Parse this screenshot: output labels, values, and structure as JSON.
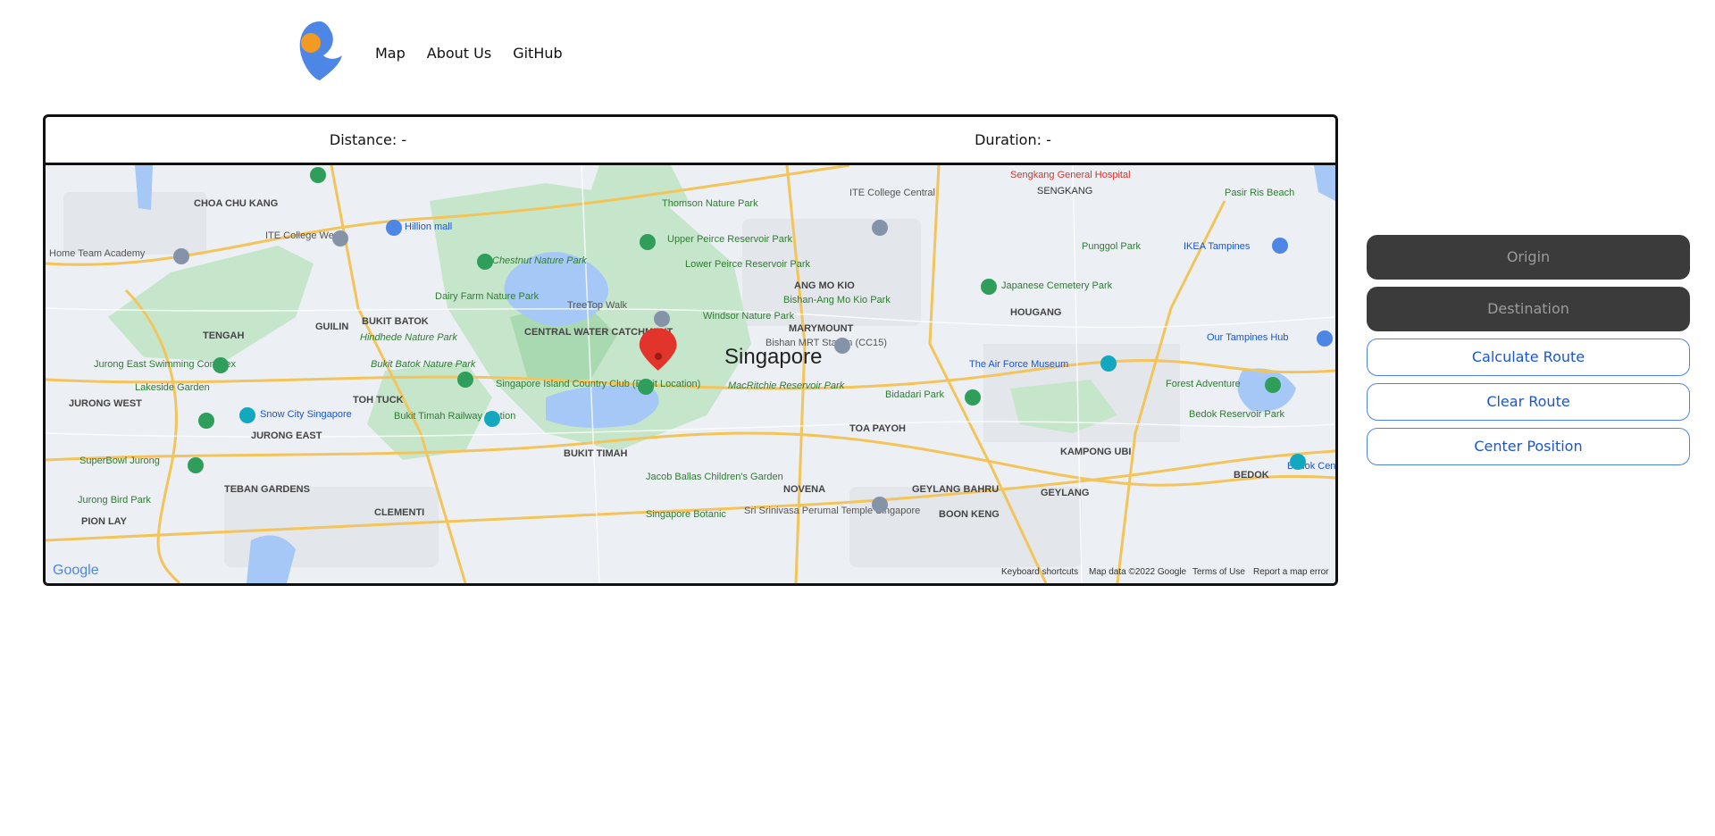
{
  "brand": {
    "logo_icon": "blue-pin-orange-dot-logo",
    "colors": {
      "logo_blue": "#4e86e6",
      "logo_orange": "#f29a24",
      "button_dark": "#3b3b3b",
      "button_link": "#1a55d6"
    }
  },
  "nav": {
    "items": [
      {
        "label": "Map"
      },
      {
        "label": "About Us"
      },
      {
        "label": "GitHub"
      }
    ]
  },
  "stats": {
    "distance_label": "Distance:",
    "distance_value": "-",
    "duration_label": "Duration:",
    "duration_value": "-"
  },
  "map": {
    "center_label": "Singapore",
    "marker_icon": "red-location-pin-icon",
    "attribution": {
      "google": "Google",
      "shortcuts": "Keyboard shortcuts",
      "map_data": "Map data ©2022 Google",
      "terms": "Terms of Use",
      "report": "Report a map error"
    },
    "labels": {
      "sengkang_hospital": "Sengkang General Hospital",
      "sengkang": "SENGKANG",
      "thomson": "Thomson Nature Park",
      "ite_central": "ITE College Central",
      "choa_chu_kang": "CHOA CHU KANG",
      "hillion": "Hillion mall",
      "ite_west": "ITE College West",
      "home_team": "Home Team Academy",
      "chestnut": "Chestnut Nature Park",
      "upper_peirce": "Upper Peirce Reservoir Park",
      "lower_peirce": "Lower Peirce Reservoir Park",
      "ang_mo_kio": "ANG MO KIO",
      "punggol_park": "Punggol Park",
      "pasir_ris": "Pasir Ris Beach",
      "ikea": "IKEA Tampines",
      "japanese_cemetery": "Japanese Cemetery Park",
      "dairy_farm": "Dairy Farm Nature Park",
      "treetop": "TreeTop Walk",
      "bishan_amk": "Bishan-Ang Mo Kio Park",
      "hougang": "HOUGANG",
      "tengah": "TENGAH",
      "guilin": "GUILIN",
      "bukit_batok": "BUKIT BATOK",
      "hindhede": "Hindhede Nature Park",
      "central_water": "CENTRAL WATER CATCHMENT",
      "windsor": "Windsor Nature Park",
      "marymount": "MARYMOUNT",
      "bishan_mrt": "Bishan MRT Station (CC15)",
      "our_tampines": "Our Tampines Hub",
      "jurong_east_swim": "Jurong East Swimming Complex",
      "bukit_batok_park": "Bukit Batok Nature Park",
      "lakeside": "Lakeside Garden",
      "sicc": "Singapore Island Country Club (Bukit Location)",
      "macritchie": "MacRitchie Reservoir Park",
      "air_force": "The Air Force Museum",
      "forest_adventure": "Forest Adventure",
      "jurong_west": "JURONG WEST",
      "toh_tuck": "TOH TUCK",
      "snow_city": "Snow City Singapore",
      "bukit_timah_rs": "Bukit Timah Railway Station",
      "bidadari": "Bidadari Park",
      "bedok_reservoir": "Bedok Reservoir Park",
      "jurong_east": "JURONG EAST",
      "toa_payoh": "TOA PAYOH",
      "kampong_ubi": "KAMPONG UBI",
      "bukit_timah": "BUKIT TIMAH",
      "superbowl": "SuperBowl Jurong",
      "bedok": "BEDOK",
      "jacob_ballas": "Jacob Ballas Children's Garden",
      "teban": "TEBAN GARDENS",
      "novena": "NOVENA",
      "geylang_bahru": "GEYLANG BAHRU",
      "geylang": "GEYLANG",
      "jurong_bird": "Jurong Bird Park",
      "clementi": "CLEMENTI",
      "srinivasa": "Sri Srinivasa Perumal Temple Singapore",
      "boon_keng": "BOON KENG",
      "sg_botanic": "Singapore Botanic",
      "pion_lay": "PION LAY",
      "bedok_centre": "Bedok Centre"
    }
  },
  "controls": {
    "origin": "Origin",
    "destination": "Destination",
    "calculate": "Calculate Route",
    "clear": "Clear Route",
    "center": "Center Position"
  }
}
